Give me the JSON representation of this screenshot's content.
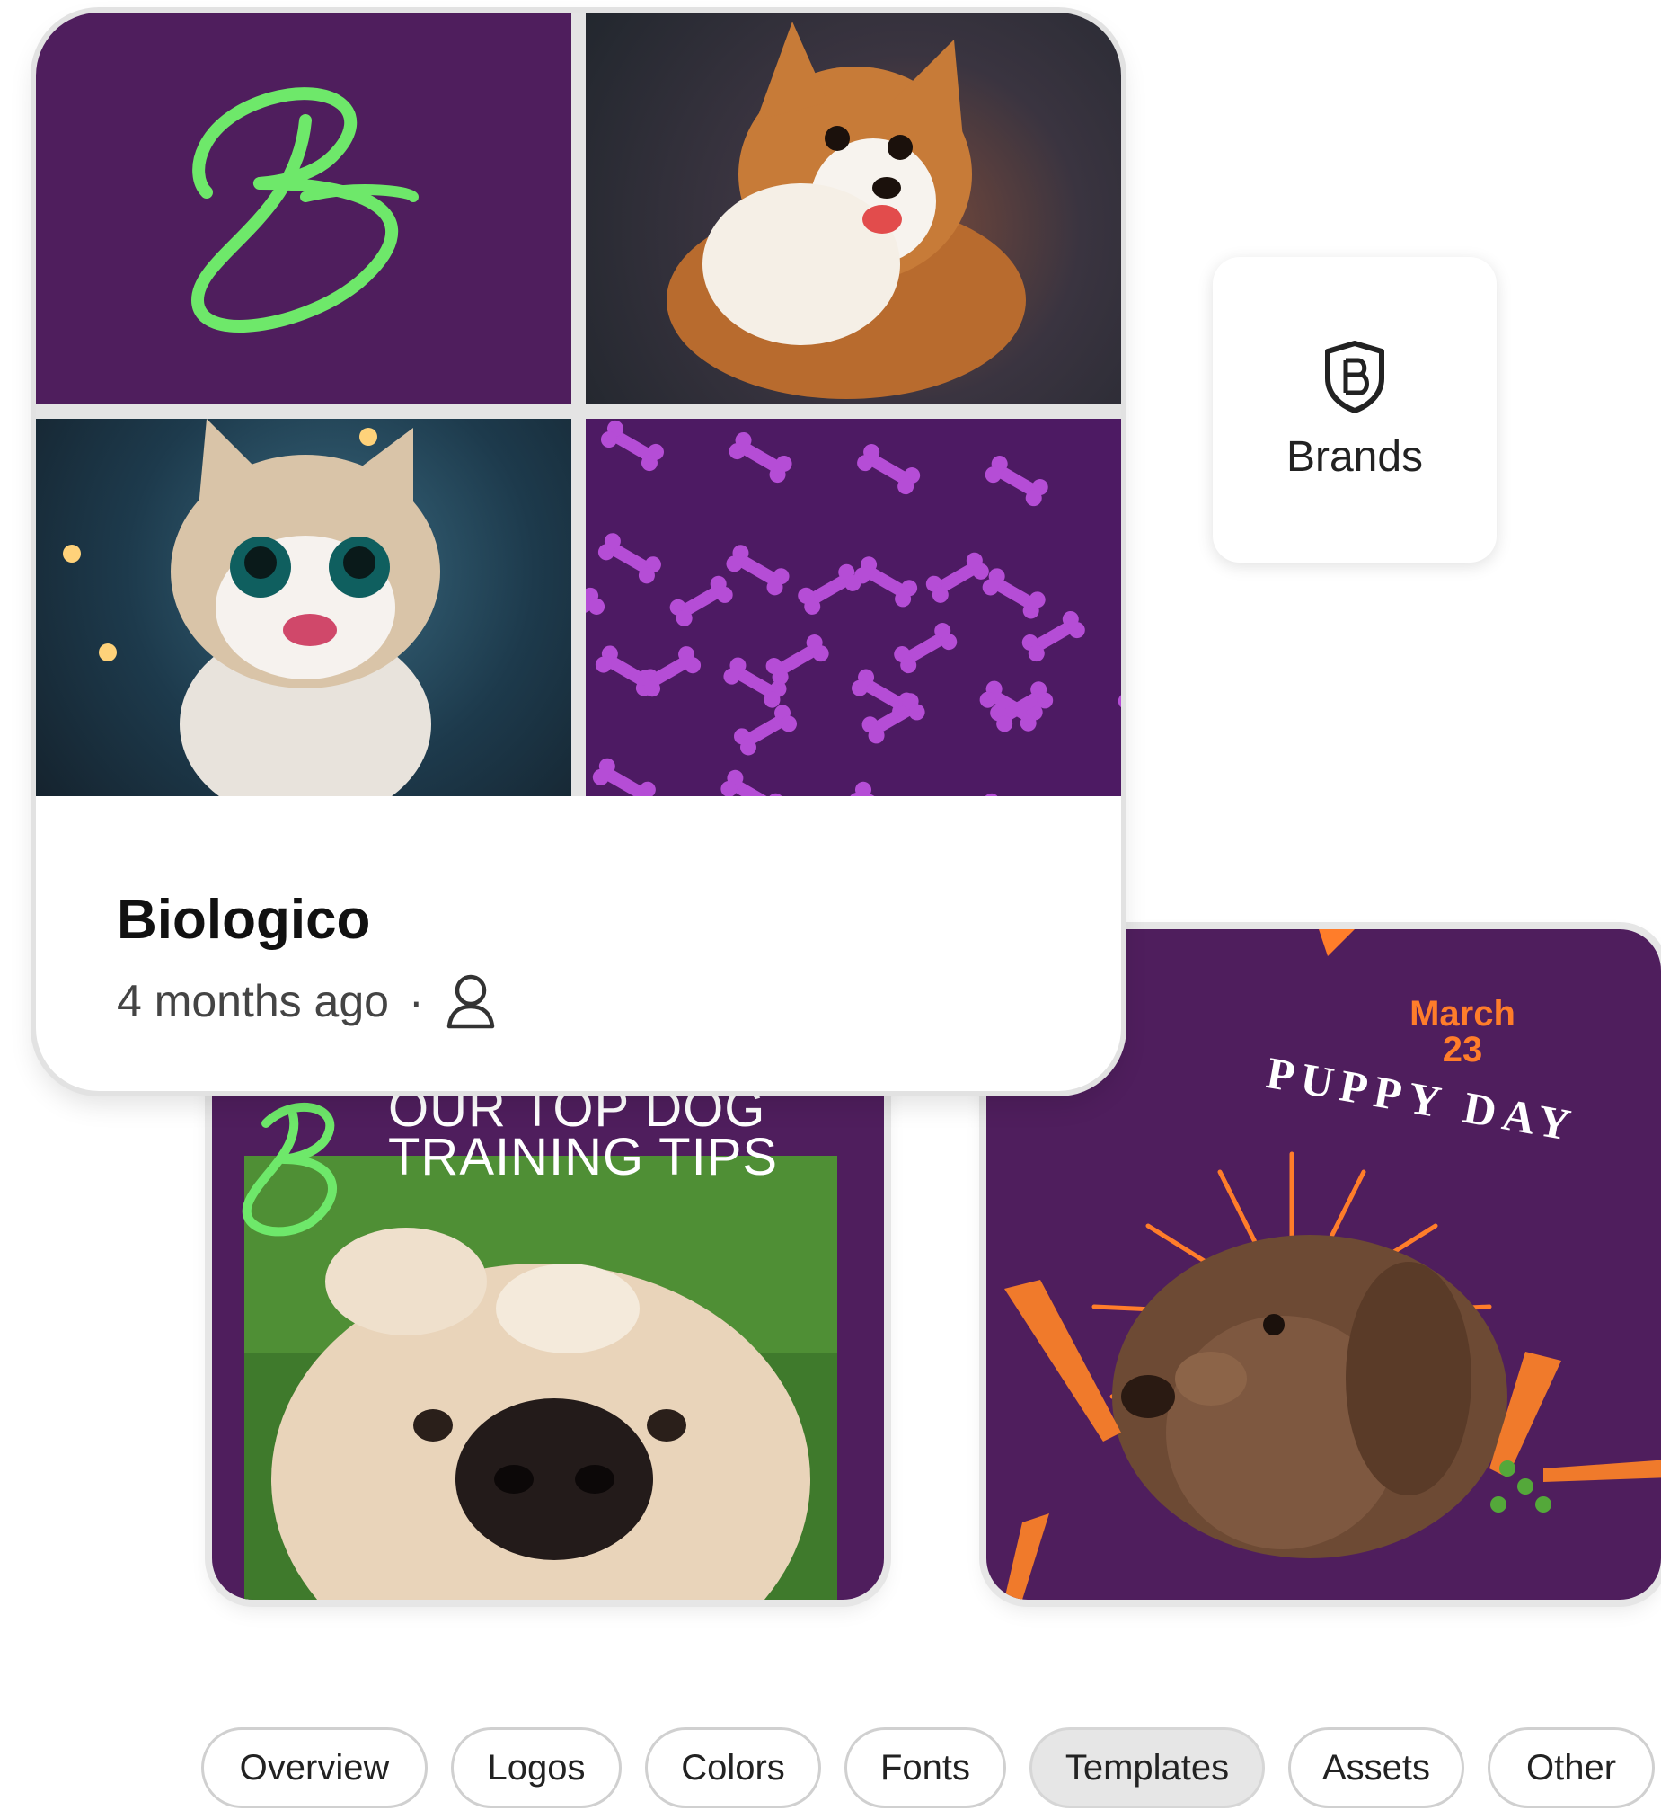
{
  "brand": {
    "name": "Biologico",
    "updated": "4 months ago",
    "separator": "·",
    "owner_icon": "user-icon",
    "logo_letter": "B"
  },
  "brands_tile": {
    "label": "Brands",
    "icon": "brand-shield-icon"
  },
  "templates": [
    {
      "line1": "OUR TOP DOG",
      "line2": "TRAINING TIPS"
    },
    {
      "date_month": "March",
      "date_day": "23",
      "arc_text": "PUPPY DAY"
    }
  ],
  "tabs": [
    {
      "label": "Overview",
      "active": false
    },
    {
      "label": "Logos",
      "active": false
    },
    {
      "label": "Colors",
      "active": false
    },
    {
      "label": "Fonts",
      "active": false
    },
    {
      "label": "Templates",
      "active": true
    },
    {
      "label": "Assets",
      "active": false
    },
    {
      "label": "Other",
      "active": false
    }
  ],
  "colors": {
    "brand_purple": "#4f1e5d",
    "logo_green": "#6ee86a",
    "accent_orange": "#ff7d2a",
    "bone_purple": "#b54dd6"
  }
}
